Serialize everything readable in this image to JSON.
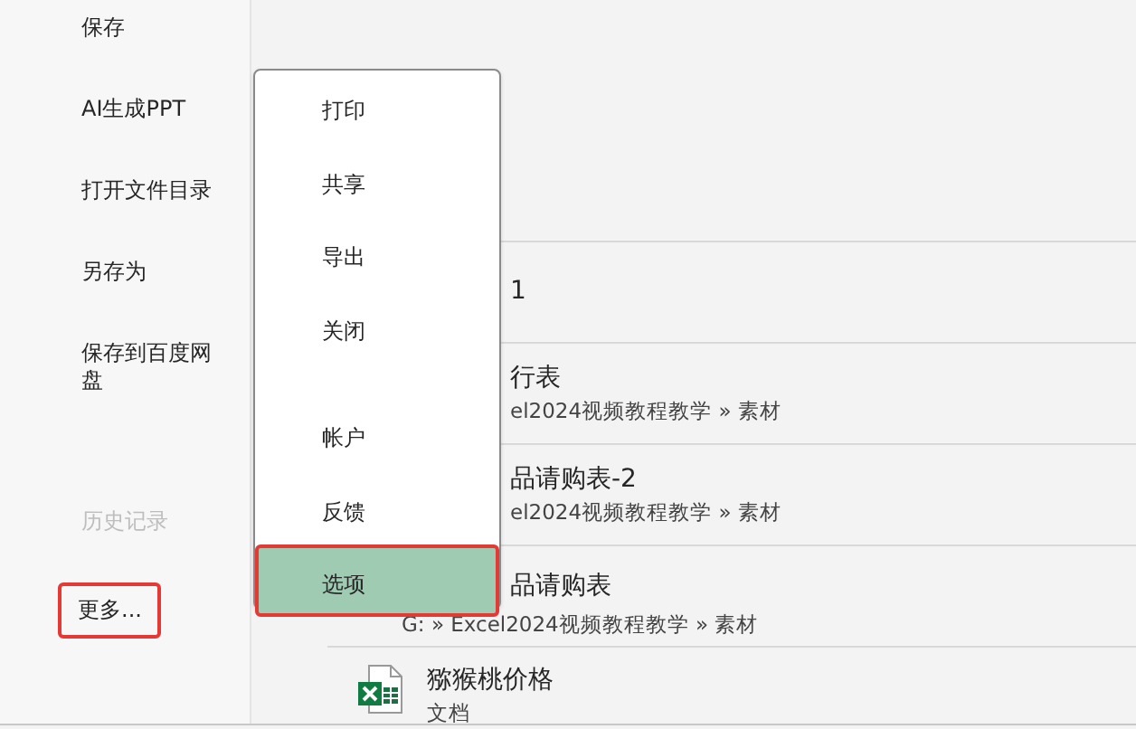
{
  "sidebar": {
    "items": [
      {
        "label": "保存",
        "disabled": false,
        "outlined": false
      },
      {
        "label": "AI生成PPT",
        "disabled": false,
        "outlined": false
      },
      {
        "label": "打开文件目录",
        "disabled": false,
        "outlined": false
      },
      {
        "label": "另存为",
        "disabled": false,
        "outlined": false
      },
      {
        "label": "保存到百度网盘",
        "disabled": false,
        "outlined": false
      },
      {
        "label": "历史记录",
        "disabled": true,
        "outlined": false
      },
      {
        "label": "更多...",
        "disabled": false,
        "outlined": true
      }
    ]
  },
  "recent_files": [
    {
      "kind": "partial",
      "title": "1"
    },
    {
      "kind": "partial",
      "title": "行表",
      "path": "el2024视频教程教学 » 素材"
    },
    {
      "kind": "partial",
      "title": "品请购表-2",
      "path": "el2024视频教程教学 » 素材"
    },
    {
      "kind": "partial",
      "title": "品请购表",
      "path": "G: » Excel2024视频教程教学 » 素材"
    },
    {
      "kind": "file",
      "title": "猕猴桃价格",
      "path": "文档"
    }
  ],
  "menu": {
    "groups": [
      [
        {
          "label": "打印",
          "selected": false,
          "outlined": false
        },
        {
          "label": "共享",
          "selected": false,
          "outlined": false
        },
        {
          "label": "导出",
          "selected": false,
          "outlined": false
        },
        {
          "label": "关闭",
          "selected": false,
          "outlined": false
        }
      ],
      [
        {
          "label": "帐户",
          "selected": false,
          "outlined": false
        },
        {
          "label": "反馈",
          "selected": false,
          "outlined": false
        },
        {
          "label": "选项",
          "selected": true,
          "outlined": true
        }
      ]
    ]
  }
}
